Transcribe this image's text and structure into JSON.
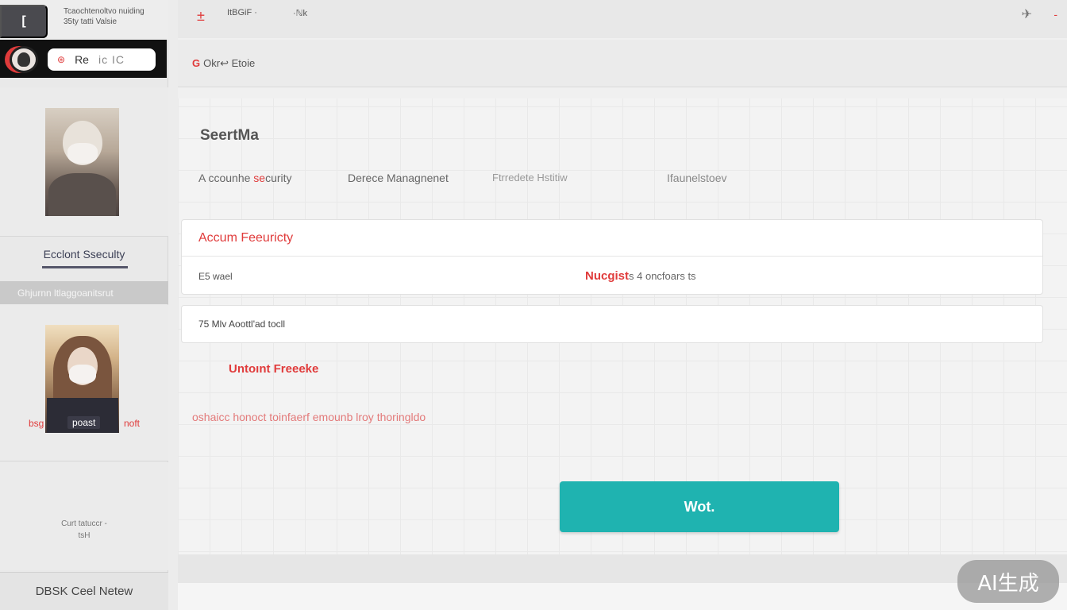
{
  "sidebar": {
    "top_button": "[",
    "top_text_line1": "Tcaochtenoltvo nuiding",
    "top_text_line2": "35ty tatti Valsie",
    "search": {
      "icon": "search-icon",
      "value": "Re",
      "placeholder": "ic IC"
    },
    "section_label": "Ecclont Sseculty",
    "section_bar": "Ghjurnn ltlaggoanitsrut",
    "card2_label_left": "bsg",
    "card2_label_mid": "poast",
    "card2_label_right": "noft",
    "small_text_line1": "Curt tatuccr -",
    "small_text_line2": "tsH",
    "footer": "DBSK Ceel Netew"
  },
  "topbar": {
    "plus": "±",
    "item1": "ItBGiF ·",
    "item2": "·ℕk",
    "right_icon": "plane-icon",
    "right_mark": "-"
  },
  "breadcrumb": {
    "icon": "G",
    "text": "Okr↩ Etoie"
  },
  "main": {
    "title": "SeertMa",
    "tabs": [
      {
        "label_prefix": "A ccounhe ",
        "label_accent": "se",
        "label_suffix": "curity"
      },
      {
        "label": "Derece Managnenet"
      },
      {
        "label": "Ftrredete Hstitiw"
      },
      {
        "label": "Ifaunelstoev"
      }
    ],
    "panel1": {
      "heading": "Accum Feeuricty",
      "row_left": "E5 wael",
      "row_right_bold": "Nucgist",
      "row_right_rest": "s 4 oncfoars ts"
    },
    "panel2": {
      "text": "75 Mlv Aoottl'ad tocll"
    },
    "freeze_heading": "Untoınt Freeeke",
    "freeze_desc": "oshaicc honoct toinfaerf emounb lroy thoringldo",
    "action_button": "Wot."
  },
  "watermark": "AI生成",
  "colors": {
    "accent": "#e03b3b",
    "button": "#1fb3b0"
  }
}
